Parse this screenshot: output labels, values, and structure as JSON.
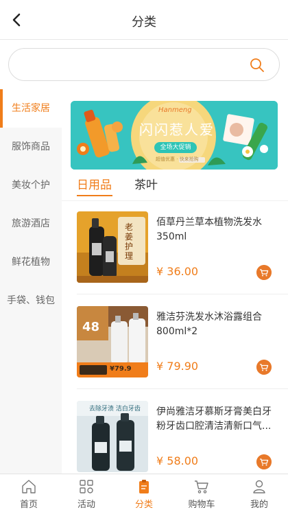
{
  "header": {
    "title": "分类",
    "back_icon": "chevron-left-icon"
  },
  "search": {
    "value": "",
    "placeholder": "",
    "icon": "search-icon"
  },
  "sidebar": {
    "items": [
      {
        "label": "生活家居",
        "active": true
      },
      {
        "label": "服饰商品",
        "active": false
      },
      {
        "label": "美妆个护",
        "active": false
      },
      {
        "label": "旅游酒店",
        "active": false
      },
      {
        "label": "鲜花植物",
        "active": false
      },
      {
        "label": "手袋、钱包",
        "active": false
      }
    ]
  },
  "banner": {
    "script_text": "Hanmeng",
    "headline": "闪闪惹人爱",
    "tag": "全场大促销",
    "small_text": "超值优惠 · 快来抢购"
  },
  "tabs": [
    {
      "label": "日用品",
      "active": true
    },
    {
      "label": "茶叶",
      "active": false
    }
  ],
  "products": [
    {
      "name": "佰草丹兰草本植物洗发水350ml",
      "price": "¥ 36.00",
      "thumb_text": "老姜护理"
    },
    {
      "name": "雅洁芬洗发水沐浴露组合800ml*2",
      "price": "¥ 79.90",
      "thumb_text": "48",
      "thumb_price": "¥79.9"
    },
    {
      "name": "伊尚雅洁牙慕斯牙膏美白牙粉牙齿口腔清洁清新口气...",
      "price": "¥ 58.00",
      "thumb_text": "去除牙渍 洁白牙齿"
    }
  ],
  "tabbar": [
    {
      "label": "首页",
      "icon": "home-icon",
      "active": false
    },
    {
      "label": "活动",
      "icon": "grid-icon",
      "active": false
    },
    {
      "label": "分类",
      "icon": "category-icon",
      "active": true
    },
    {
      "label": "购物车",
      "icon": "cart-icon",
      "active": false
    },
    {
      "label": "我的",
      "icon": "user-icon",
      "active": false
    }
  ],
  "colors": {
    "accent": "#f07d1a",
    "sidebar_bg": "#f7f7f7",
    "banner_bg": "#37c4c0"
  }
}
